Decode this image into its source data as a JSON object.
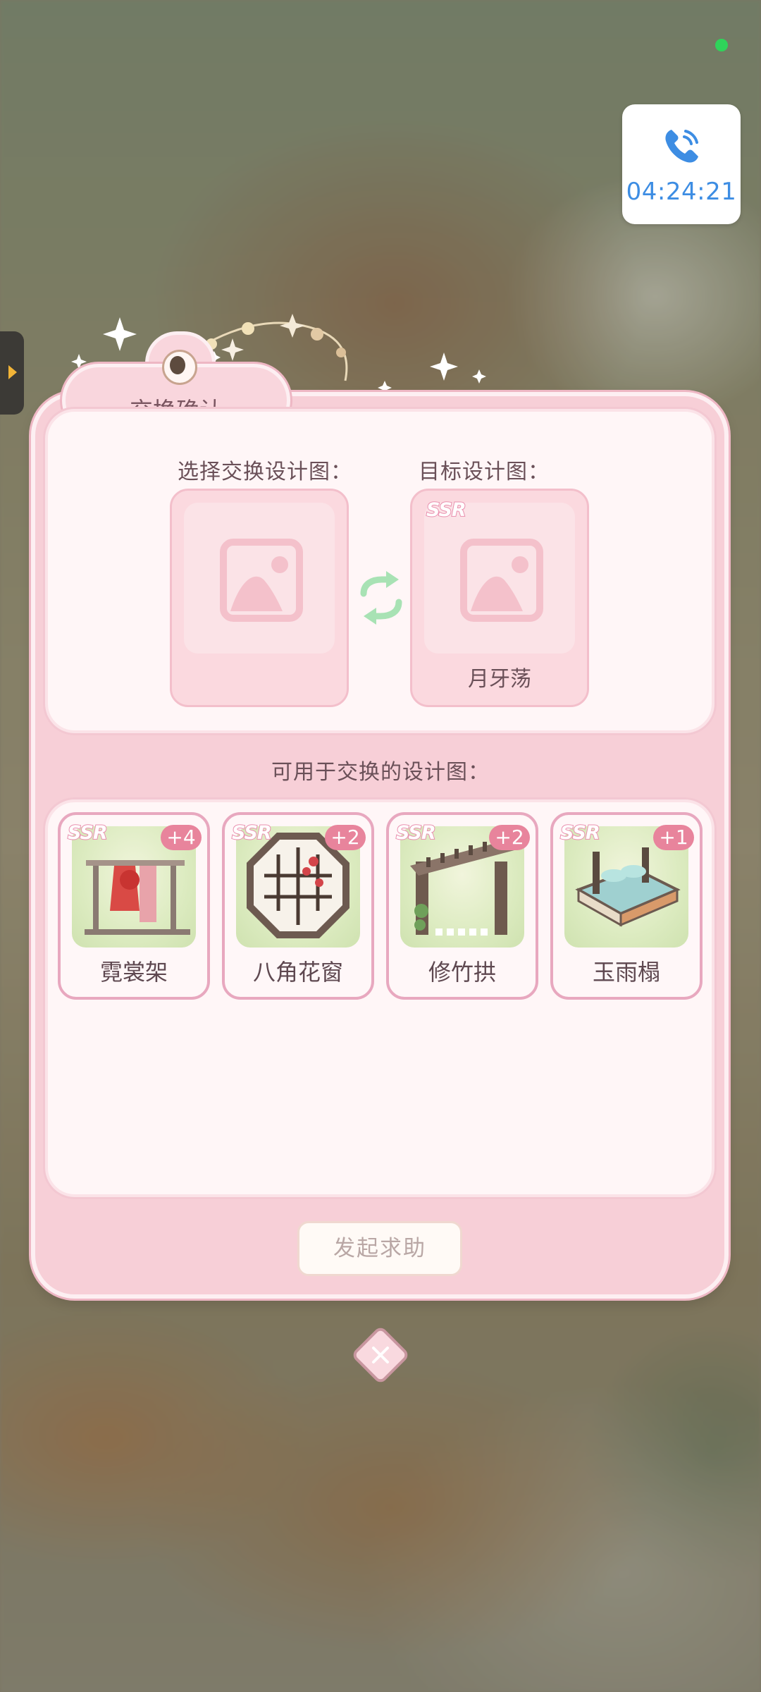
{
  "status": {
    "indicator_color": "#2fd45a"
  },
  "call_widget": {
    "icon": "phone-icon",
    "timer": "04:24:21",
    "accent": "#3d8de3"
  },
  "dialog": {
    "title": "交换确认",
    "select_label": "选择交换设计图：",
    "target_label": "目标设计图：",
    "target": {
      "rarity": "SSR",
      "name": "月牙荡",
      "icon": "image-placeholder-icon"
    },
    "selected": {
      "icon": "image-placeholder-icon"
    },
    "swap_icon": "swap-arrows-icon",
    "available_label": "可用于交换的设计图：",
    "cards": [
      {
        "rarity": "SSR",
        "count": "+4",
        "name": "霓裳架"
      },
      {
        "rarity": "SSR",
        "count": "+2",
        "name": "八角花窗"
      },
      {
        "rarity": "SSR",
        "count": "+2",
        "name": "修竹拱"
      },
      {
        "rarity": "SSR",
        "count": "+1",
        "name": "玉雨榻"
      }
    ],
    "help_button": "发起求助",
    "close_icon": "close-icon"
  }
}
